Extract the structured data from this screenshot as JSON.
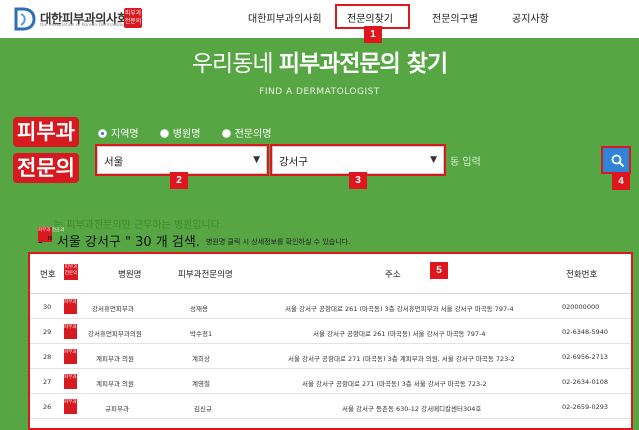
{
  "header": {
    "logo_text": "대한피부과의사회",
    "logo_sub": "the Association of Korean Dermatologists",
    "seal_text": "피부과 전문의",
    "nav": [
      {
        "label": "대한피부과의사회"
      },
      {
        "label": "전문의찾기"
      },
      {
        "label": "전문의구별"
      },
      {
        "label": "공지사항"
      }
    ]
  },
  "hero": {
    "title_light": "우리동네",
    "title_bold": "피부과전문의 찾기",
    "subtitle": "FIND A DERMATOLOGIST"
  },
  "search": {
    "side_label_line1": "피부과",
    "side_label_line2": "전문의",
    "radios": [
      {
        "label": "지역명",
        "checked": true
      },
      {
        "label": "병원명",
        "checked": false
      },
      {
        "label": "전문의명",
        "checked": false
      }
    ],
    "region_value": "서울",
    "district_value": "강서구",
    "input_placeholder": "동 입력"
  },
  "badges": [
    "1",
    "2",
    "3",
    "4",
    "5"
  ],
  "results": {
    "note": "는 피부과전문의만 근무하는 병원입니다.",
    "count_text": "- \" 서울 강서구 \" 30 개 검색.",
    "count_hint": "병원명 클릭 시 상세정보를 확인하실 수 있습니다.",
    "columns": {
      "no": "번호",
      "seal": "피부과 전문의",
      "hospital": "병원명",
      "doctor": "피부과전문의명",
      "address": "주소",
      "phone": "전화번호"
    },
    "rows": [
      {
        "no": "30",
        "hospital": "강서휴먼피부과",
        "doctor": "성재용",
        "address": "서울 강서구 공항대로 261 (마곡동) 3층 강서휴먼피부과 서울 강서구 마곡동 797-4",
        "phone": "020000000"
      },
      {
        "no": "29",
        "hospital": "강서휴먼피부과의원",
        "doctor": "박수정1",
        "address": "서울 강서구 공항대로 261 (마곡동) 서울 강서구 마곡동 797-4",
        "phone": "02-6348-5940"
      },
      {
        "no": "28",
        "hospital": "계피부과 의원",
        "doctor": "계희상",
        "address": "서울 강서구 공항대로 271 (마곡동) 3층 계피부과 의원, 서울 강서구 마곡동 723-2",
        "phone": "02-6956-2713"
      },
      {
        "no": "27",
        "hospital": "계피부과 의원",
        "doctor": "계영철",
        "address": "서울 강서구 공항대로 271 (마곡동) 3층 서울 강서구 마곡동 723-2",
        "phone": "02-2634-0108"
      },
      {
        "no": "26",
        "hospital": "규피부과",
        "doctor": "김신규",
        "address": "서울 강서구 등촌동 630-12 강서메디칼센터304호",
        "phone": "02-2659-0293"
      }
    ]
  }
}
